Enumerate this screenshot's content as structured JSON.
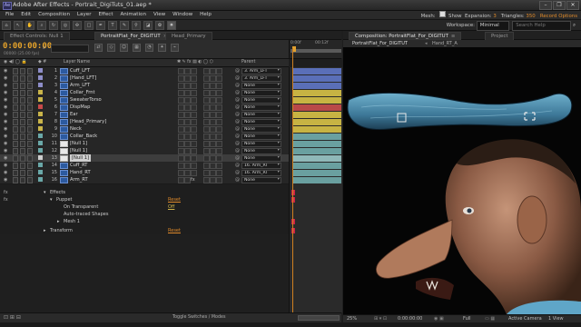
{
  "app": {
    "title": "Adobe After Effects - Portrait_DigiTuts_01.aep *",
    "logo": "Ae",
    "window_controls": [
      "–",
      "❐",
      "✕"
    ]
  },
  "menu": {
    "items": [
      "File",
      "Edit",
      "Composition",
      "Layer",
      "Effect",
      "Animation",
      "View",
      "Window",
      "Help"
    ],
    "mesh_label": "Mesh:",
    "show_label": "Show",
    "expansion_label": "Expansion:",
    "expansion_value": "3",
    "triangles_label": "Triangles:",
    "triangles_value": "350",
    "record_label": "Record Options"
  },
  "toolbar": {
    "workspace_label": "Workspace:",
    "workspace_value": "Minimal",
    "search_placeholder": "Search Help"
  },
  "timeline_tabs": [
    {
      "label": "Effect Controls: Null 1"
    },
    {
      "label": "PortraitFlat_For_DIGITUT"
    },
    {
      "label": "Head_Primary"
    }
  ],
  "timeline": {
    "timecode": "0:00:00:00",
    "fps": "00000 (25.00 fps)",
    "ruler_start": "0:00f",
    "ruler_mark": "00:12f",
    "col_layer_name": "Layer Name",
    "col_parent": "Parent",
    "footer": "Toggle Switches / Modes"
  },
  "layers": [
    {
      "num": "1",
      "name": "Cuff_LFT",
      "parent": "3. Arm_LFT",
      "label_color": "#8e8ec8",
      "bar": "#5a6fb8"
    },
    {
      "num": "2",
      "name": "[Hand_LFT]",
      "parent": "3. Arm_LFT",
      "label_color": "#8e8ec8",
      "bar": "#5a6fb8"
    },
    {
      "num": "3",
      "name": "Arm_LFT",
      "parent": "None",
      "label_color": "#8e8ec8",
      "bar": "#5a6fb8"
    },
    {
      "num": "4",
      "name": "Collar_Frnt",
      "parent": "None",
      "label_color": "#c9b44a",
      "bar": "#c7b343"
    },
    {
      "num": "5",
      "name": "SweaterTorso",
      "parent": "None",
      "label_color": "#c9b44a",
      "bar": "#c7b343"
    },
    {
      "num": "6",
      "name": "DispMap",
      "parent": "None",
      "label_color": "#c84a4a",
      "bar": "#b94848"
    },
    {
      "num": "7",
      "name": "Ear",
      "parent": "None",
      "label_color": "#c9b44a",
      "bar": "#c7b343"
    },
    {
      "num": "8",
      "name": "[Head_Primary]",
      "parent": "None",
      "label_color": "#c9b44a",
      "bar": "#c7b343"
    },
    {
      "num": "9",
      "name": "Neck",
      "parent": "None",
      "label_color": "#c9b44a",
      "bar": "#c7b343"
    },
    {
      "num": "10",
      "name": "Collar_Back",
      "parent": "None",
      "label_color": "#6aa8a8",
      "bar": "#6aa0a0"
    },
    {
      "num": "11",
      "name": "[Null 1]",
      "parent": "None",
      "label_color": "#6aa8a8",
      "bar": "#6aa0a0"
    },
    {
      "num": "12",
      "name": "[Null 1]",
      "parent": "None",
      "label_color": "#6aa8a8",
      "bar": "#6aa0a0"
    },
    {
      "num": "13",
      "name": "[Null 1]",
      "parent": "None",
      "label_color": "#cfcfcf",
      "bar": "#8fb8b8"
    },
    {
      "num": "14",
      "name": "Cuff_RT",
      "parent": "16. Arm_RT",
      "label_color": "#6aa8a8",
      "bar": "#6aa0a0"
    },
    {
      "num": "15",
      "name": "Hand_RT",
      "parent": "16. Arm_RT",
      "label_color": "#6aa8a8",
      "bar": "#6aa0a0"
    },
    {
      "num": "16",
      "name": "Arm_RT",
      "parent": "None",
      "label_color": "#6aa8a8",
      "bar": "#6aa0a0"
    }
  ],
  "properties": {
    "effects": "Effects",
    "puppet": "Puppet",
    "puppet_reset": "Reset",
    "on_transparent": "On Transparent",
    "on_transparent_value": "Off",
    "auto_traced": "Auto-traced Shapes",
    "mesh1": "Mesh 1",
    "transform": "Transform",
    "transform_reset": "Reset"
  },
  "comp_panel": {
    "tab_label": "Composition: PortraitFlat_For_DIGITUT",
    "tab_project": "Project",
    "bar_item1": "PortraitFlat_For_DIGITUT",
    "bar_item2": "Hand_RT_A",
    "zoom": "25%",
    "timecode": "0:00:00:00",
    "resolution": "Full",
    "camera": "Active Camera",
    "views": "1 View"
  }
}
